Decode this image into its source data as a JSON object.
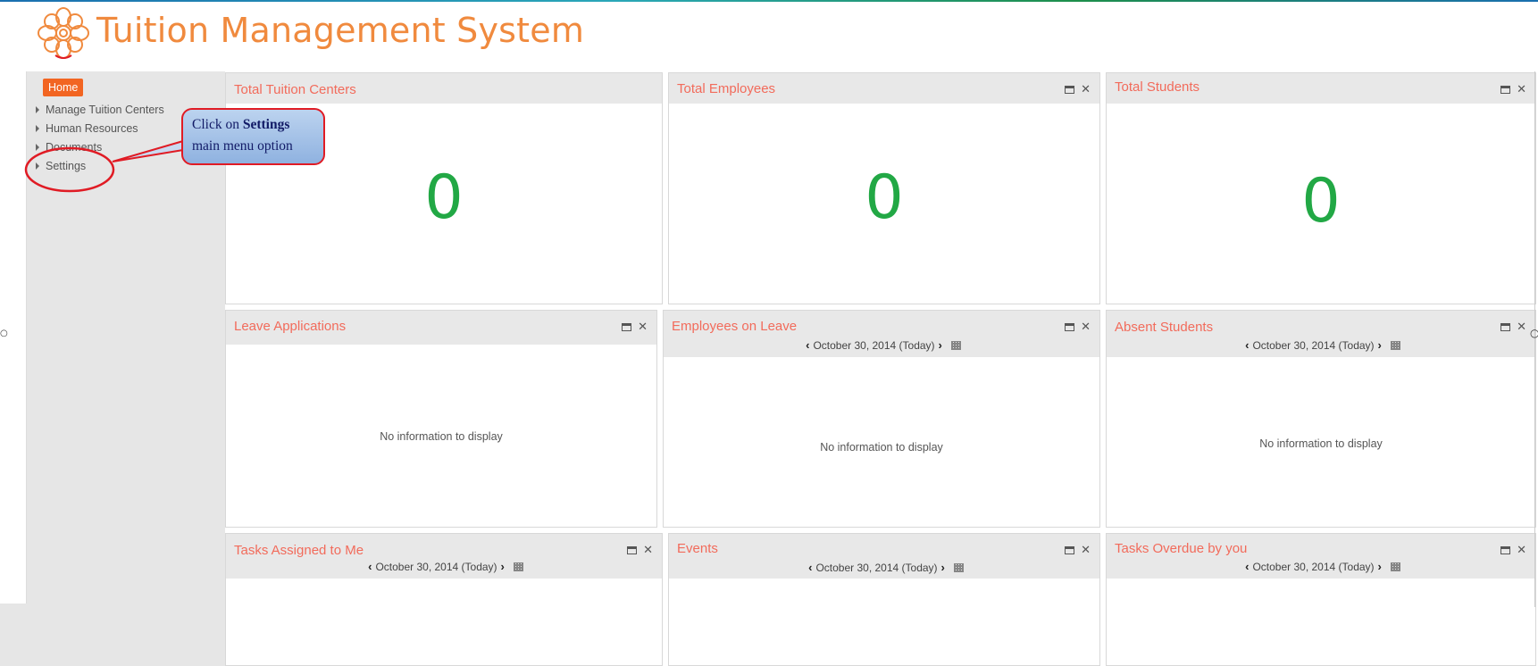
{
  "header": {
    "title": "Tuition Management System",
    "logo_icon": "flower-logo-icon",
    "accent": "#f08a3e"
  },
  "sidebar": {
    "home_label": "Home",
    "items": [
      {
        "label": "Manage Tuition Centers"
      },
      {
        "label": "Human Resources"
      },
      {
        "label": "Documents"
      },
      {
        "label": "Settings"
      }
    ]
  },
  "callout": {
    "prefix": "Click on ",
    "bold": "Settings",
    "suffix": "main menu option"
  },
  "panels": {
    "total_tuition_centers": {
      "title": "Total Tuition Centers",
      "value": "0"
    },
    "total_employees": {
      "title": "Total Employees",
      "value": "0"
    },
    "total_students": {
      "title": "Total Students",
      "value": "0"
    },
    "leave_applications": {
      "title": "Leave Applications",
      "empty": "No information to display"
    },
    "employees_on_leave": {
      "title": "Employees on Leave",
      "date": "October 30, 2014 (Today)",
      "empty": "No information to display"
    },
    "absent_students": {
      "title": "Absent Students",
      "date": "October 30, 2014 (Today)",
      "empty": "No information to display"
    },
    "tasks_assigned": {
      "title": "Tasks Assigned to Me",
      "date": "October 30, 2014 (Today)"
    },
    "events": {
      "title": "Events",
      "date": "October 30, 2014 (Today)"
    },
    "tasks_overdue": {
      "title": "Tasks Overdue by you",
      "date": "October 30, 2014 (Today)"
    }
  },
  "colors": {
    "panel_title": "#f26b5b",
    "big_number": "#22a845",
    "home_button": "#f26522",
    "annotation_red": "#e01b24"
  }
}
